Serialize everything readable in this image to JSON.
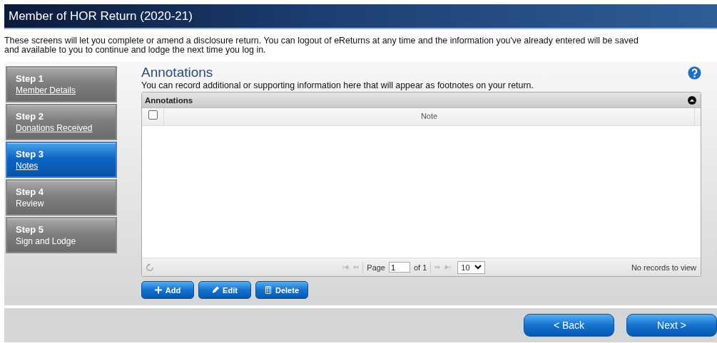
{
  "window": {
    "title": "Member of HOR Return (2020-21)"
  },
  "intro": "These screens will let you complete or amend a disclosure return. You can logout of eReturns at any time and the information you've already entered will be saved and available to you to continue and lodge the next time you log in.",
  "steps": [
    {
      "step": "Step 1",
      "label": "Member Details",
      "linked": true,
      "selected": false
    },
    {
      "step": "Step 2",
      "label": "Donations Received",
      "linked": true,
      "selected": false
    },
    {
      "step": "Step 3",
      "label": "Notes",
      "linked": true,
      "selected": true
    },
    {
      "step": "Step 4",
      "label": "Review",
      "linked": false,
      "selected": false
    },
    {
      "step": "Step 5",
      "label": "Sign and Lodge",
      "linked": false,
      "selected": false
    }
  ],
  "section": {
    "title": "Annotations",
    "description": "You can record additional or supporting information here that will appear as footnotes on your return."
  },
  "grid": {
    "caption": "Annotations",
    "select_all_checked": false,
    "columns": [
      "Note"
    ],
    "pager": {
      "page_label": "Page",
      "page": "1",
      "of_label": "of 1",
      "page_size": "10",
      "status": "No records to view"
    }
  },
  "actions": [
    {
      "kind": "add",
      "label": "Add"
    },
    {
      "kind": "edit",
      "label": "Edit"
    },
    {
      "kind": "delete",
      "label": "Delete"
    }
  ],
  "nav": [
    "< Back",
    "Next >"
  ]
}
